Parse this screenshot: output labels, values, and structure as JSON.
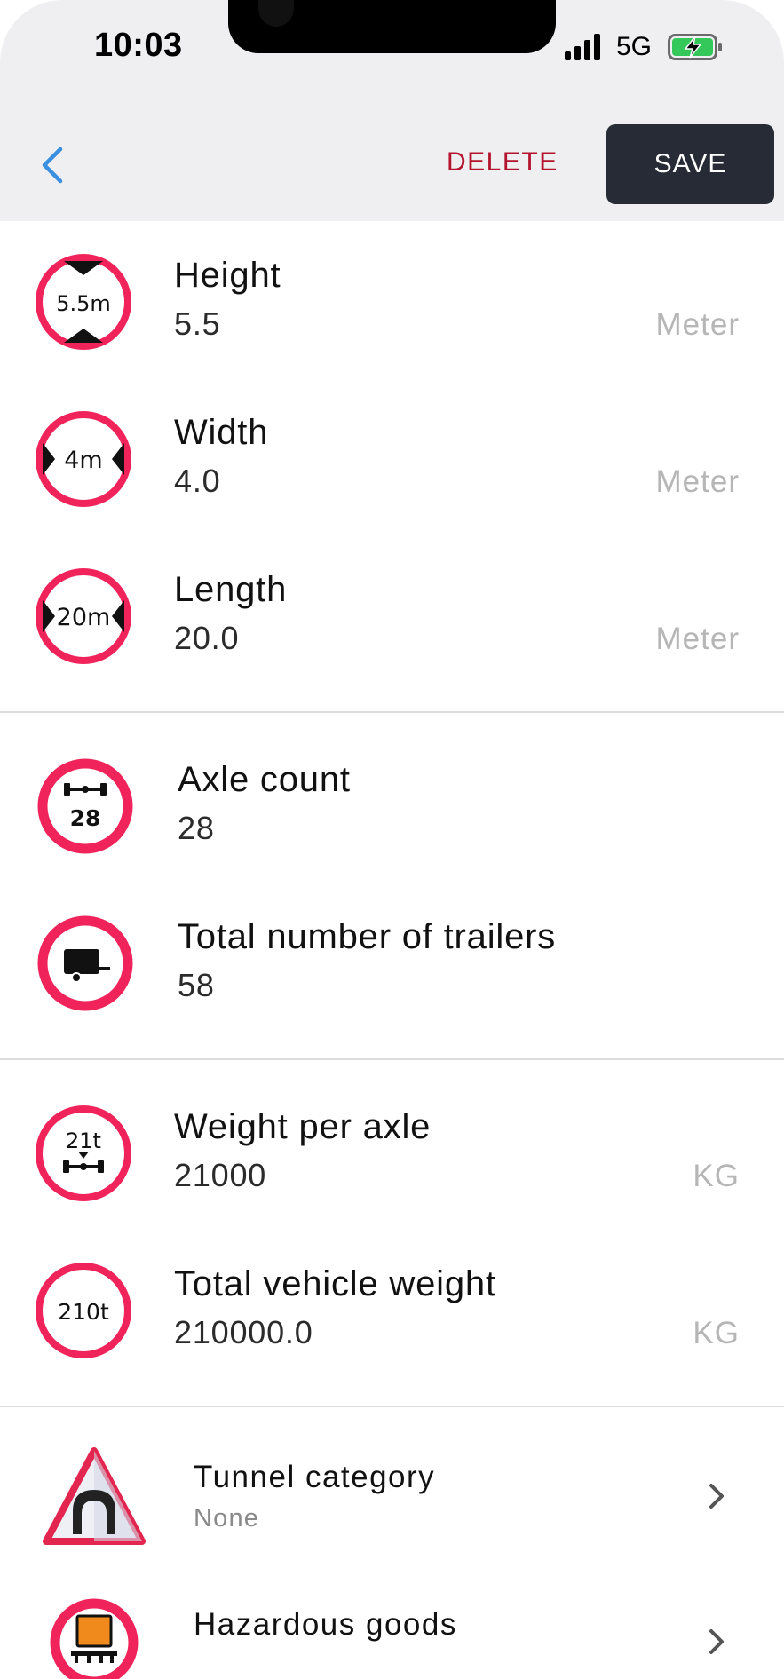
{
  "status_bar": {
    "time": "10:03",
    "network": "5G"
  },
  "toolbar": {
    "delete_label": "DELETE",
    "save_label": "SAVE"
  },
  "dimensions": [
    {
      "title": "Height",
      "value": "5.5",
      "unit": "Meter",
      "sign": "5.5m"
    },
    {
      "title": "Width",
      "value": "4.0",
      "unit": "Meter",
      "sign": "4m"
    },
    {
      "title": "Length",
      "value": "20.0",
      "unit": "Meter",
      "sign": "20m"
    }
  ],
  "counts": [
    {
      "title": "Axle count",
      "value": "28",
      "sign": "28"
    },
    {
      "title": "Total number of trailers",
      "value": "58"
    }
  ],
  "weights": [
    {
      "title": "Weight per axle",
      "value": "21000",
      "unit": "KG",
      "sign": "21t"
    },
    {
      "title": "Total vehicle weight",
      "value": "210000.0",
      "unit": "KG",
      "sign": "210t"
    }
  ],
  "settings": [
    {
      "title": "Tunnel category",
      "value": "None"
    },
    {
      "title": "Hazardous goods"
    }
  ],
  "colors": {
    "sign_red": "#f0245a",
    "accent_blue": "#3a8fe0",
    "delete_red": "#b3132c",
    "save_bg": "#262b36"
  }
}
